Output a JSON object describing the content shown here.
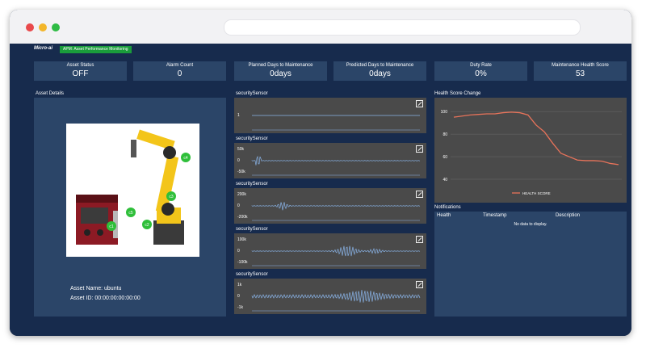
{
  "browser": {
    "dot_colors": [
      "#e9494b",
      "#f3b62a",
      "#2fbb44"
    ]
  },
  "app": {
    "logo": "Micro-ai",
    "badge": "APM: Asset Performance Monitoring"
  },
  "kpis": [
    {
      "label": "Asset Status",
      "value": "OFF"
    },
    {
      "label": "Alarm Count",
      "value": "0"
    },
    {
      "label": "Planned Days to Maintenance",
      "value": "0days"
    },
    {
      "label": "Predicted Days to Maintenance",
      "value": "0days"
    },
    {
      "label": "Duty Rate",
      "value": "0%"
    },
    {
      "label": "Maintenance Health Score",
      "value": "53"
    }
  ],
  "asset_details": {
    "title": "Asset Details",
    "asset_name": "Asset Name: ubuntu",
    "asset_id": "Asset ID: 00:00:00:00:00:00",
    "robot_labels": [
      "c4",
      "c3",
      "c5",
      "c2",
      "c1"
    ]
  },
  "sensors": [
    {
      "title": "securitySensor",
      "ticks": [
        "1"
      ]
    },
    {
      "title": "securitySensor",
      "ticks": [
        "50k",
        "0",
        "-50k"
      ]
    },
    {
      "title": "securitySensor",
      "ticks": [
        "200k",
        "0",
        "-200k"
      ]
    },
    {
      "title": "securitySensor",
      "ticks": [
        "100k",
        "0",
        "-100k"
      ]
    },
    {
      "title": "securitySensor",
      "ticks": [
        "1k",
        "0",
        "-1k"
      ]
    }
  ],
  "chart_data": {
    "type": "line",
    "title": "Health Score Change",
    "xlabel": "",
    "ylabel": "",
    "ylim": [
      35,
      108
    ],
    "yticks": [
      100,
      80,
      60,
      40
    ],
    "grid": true,
    "legend_position": "bottom",
    "series": [
      {
        "name": "HEALTH SCORE",
        "color": "#e8735a",
        "x": [
          0,
          1,
          2,
          3,
          4,
          5,
          6,
          7,
          8,
          9,
          10,
          11,
          12,
          13,
          14,
          15,
          16,
          17,
          18,
          19,
          20
        ],
        "values": [
          95,
          96,
          97,
          97.5,
          98,
          98,
          99,
          99.5,
          99,
          97,
          88,
          82,
          72,
          63,
          60,
          57,
          56.5,
          56.5,
          56,
          54,
          53
        ]
      }
    ]
  },
  "notifications": {
    "title": "Notifications",
    "columns": [
      "Health",
      "Timestamp",
      "Description"
    ],
    "empty_text": "No data to display."
  }
}
